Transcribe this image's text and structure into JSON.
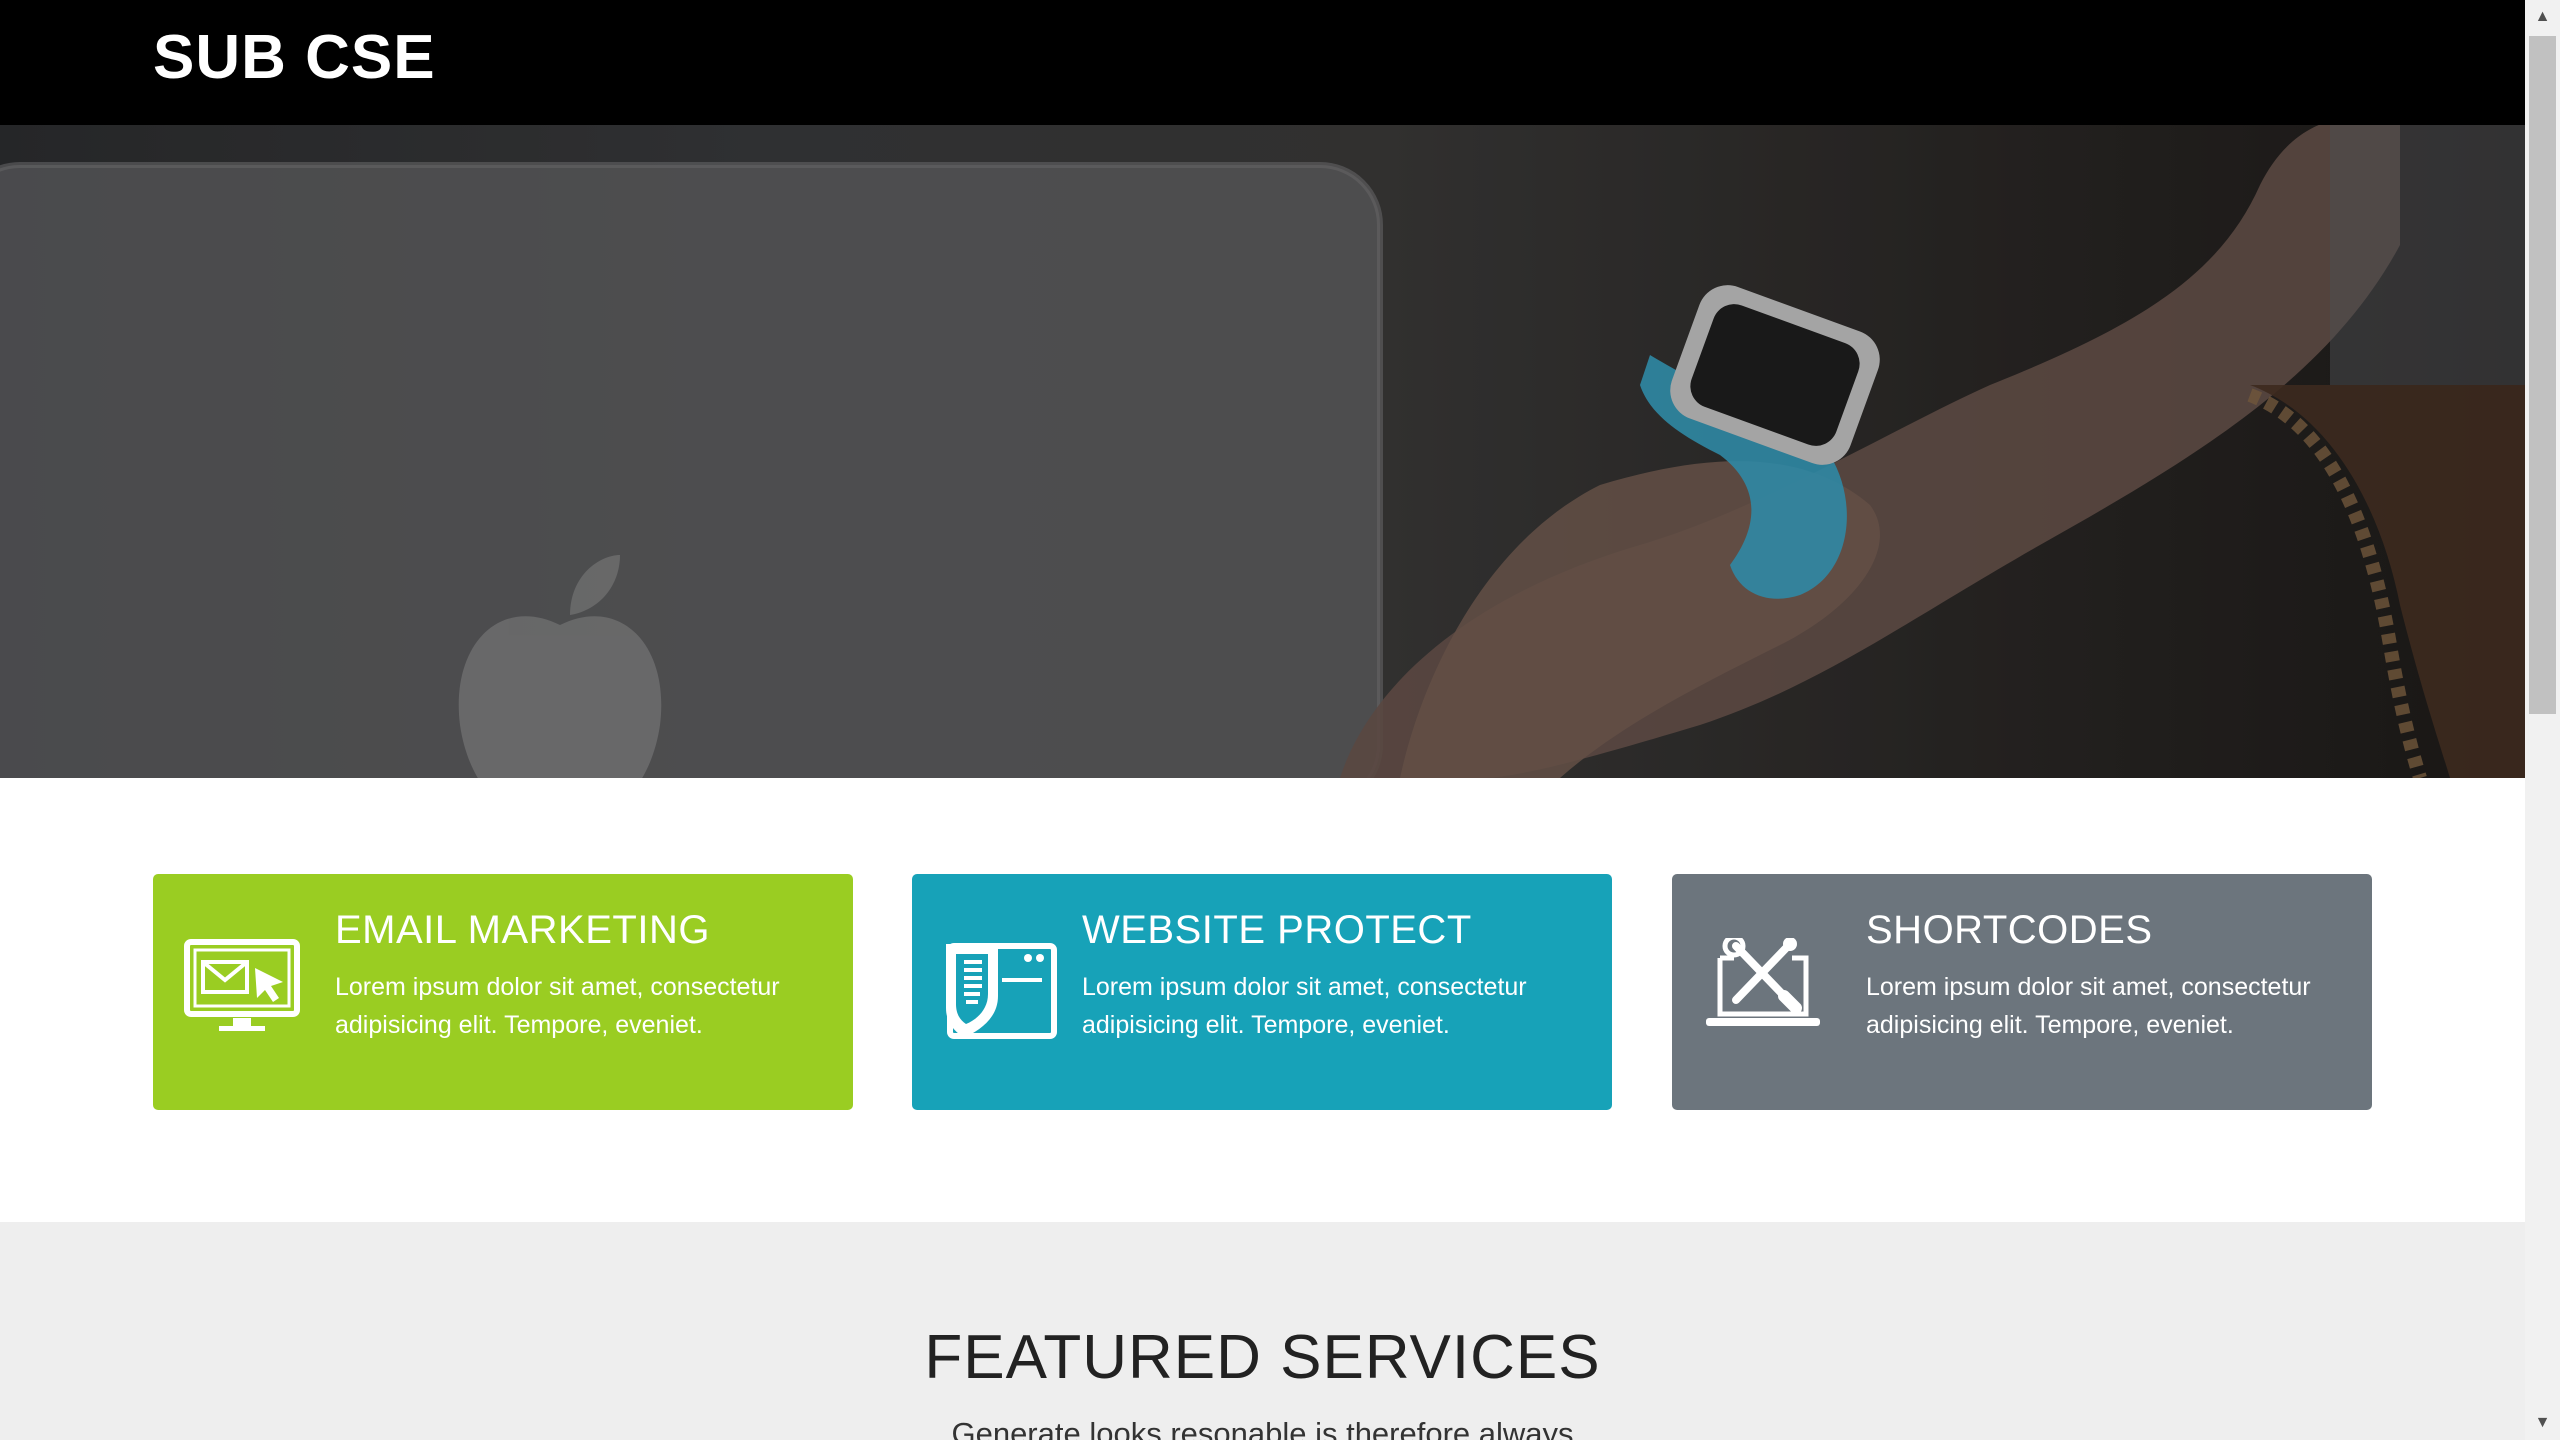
{
  "header": {
    "brand": "SUB CSE"
  },
  "hero": {
    "image": "person-with-laptop-and-smartwatch"
  },
  "features": [
    {
      "title": "EMAIL MARKETING",
      "text": "Lorem ipsum dolor sit amet, consectetur adipisicing elit. Tempore, eveniet.",
      "icon": "email-monitor-icon",
      "color": "#9acd22"
    },
    {
      "title": "WEBSITE PROTECT",
      "text": "Lorem ipsum dolor sit amet, consectetur adipisicing elit. Tempore, eveniet.",
      "icon": "shield-window-icon",
      "color": "#17a2b8"
    },
    {
      "title": "SHORTCODES",
      "text": "Lorem ipsum dolor sit amet, consectetur adipisicing elit. Tempore, eveniet.",
      "icon": "laptop-tools-icon",
      "color": "#6c757d"
    }
  ],
  "services": {
    "heading": "FEATURED SERVICES",
    "subtext": "Generate looks resonable is therefore always"
  },
  "scrollbar": {
    "up_glyph": "▲",
    "down_glyph": "▼"
  }
}
